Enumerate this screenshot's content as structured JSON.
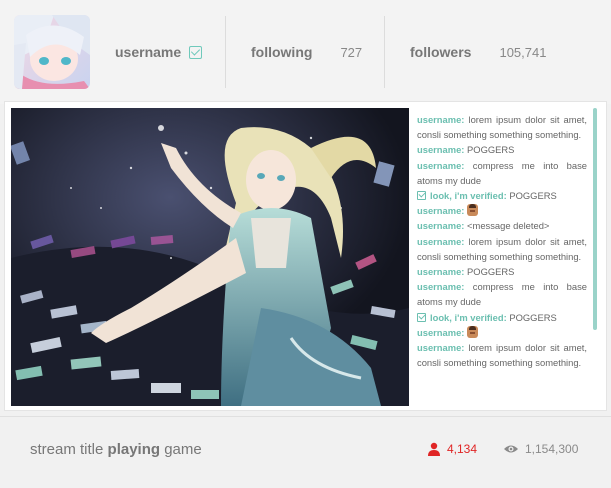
{
  "profile": {
    "username": "username",
    "following_label": "following",
    "following_count": "727",
    "followers_label": "followers",
    "followers_count": "105,741"
  },
  "chat": {
    "messages": [
      {
        "user": "username:",
        "text": "lorem ipsum dolor sit amet, consli something something something."
      },
      {
        "user": "username:",
        "text": "POGGERS"
      },
      {
        "user": "username:",
        "text": "compress me into base atoms my dude"
      },
      {
        "user": "look, i'm verified:",
        "text": "POGGERS",
        "verified": true
      },
      {
        "user": "username:",
        "text": "",
        "emote": true
      },
      {
        "user": "username:",
        "text": "<message deleted>"
      },
      {
        "user": "username:",
        "text": "lorem ipsum dolor sit amet, consli something something something."
      },
      {
        "user": "username:",
        "text": "POGGERS"
      },
      {
        "user": "username:",
        "text": "compress me into base atoms my dude"
      },
      {
        "user": "look, i'm verified:",
        "text": "POGGERS",
        "verified": true
      },
      {
        "user": "username:",
        "text": "",
        "emote": true
      },
      {
        "user": "username:",
        "text": "lorem ipsum dolor sit amet, consli something something something."
      }
    ]
  },
  "stream": {
    "title_prefix": "stream title",
    "title_bold": "playing",
    "title_suffix": "game",
    "viewers": "4,134",
    "views": "1,154,300"
  },
  "colors": {
    "accent": "#6bbfb0",
    "live_red": "#e02525"
  },
  "icons": {
    "verified": "check-square-icon",
    "viewers": "person-icon",
    "views": "eye-icon"
  }
}
